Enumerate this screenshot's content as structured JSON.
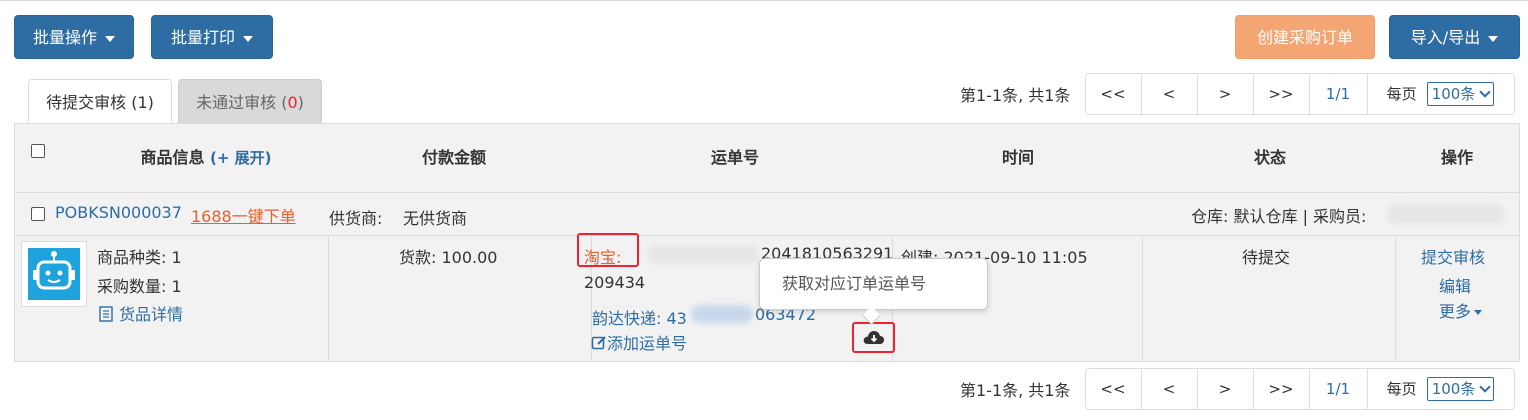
{
  "toolbar": {
    "batch_ops": "批量操作",
    "batch_print": "批量打印",
    "create_po": "创建采购订单",
    "import_export": "导入/导出"
  },
  "tabs": {
    "pending_label": "待提交审核",
    "pending_count": "(1)",
    "rejected_label": "未通过审核",
    "rejected_count_open": "(",
    "rejected_count": "0",
    "rejected_count_close": ")"
  },
  "pager": {
    "summary": "第1-1条, 共1条",
    "first": "<<",
    "prev": "<",
    "next": ">",
    "last": ">>",
    "page": "1/1",
    "per_page_label": "每页",
    "per_page_value": "100条"
  },
  "table": {
    "headers": {
      "product": "商品信息",
      "expand": "(+ 展开)",
      "amount": "付款金额",
      "tracking": "运单号",
      "time": "时间",
      "status": "状态",
      "action": "操作"
    },
    "order": {
      "po_number": "POBKSN000037",
      "quick_order": "1688一键下单",
      "supplier_label": "供货商:",
      "supplier_value": "无供货商",
      "warehouse": "仓库: 默认仓库 | 采购员:"
    },
    "row": {
      "kinds": "商品种类: 1",
      "qty": "采购数量: 1",
      "detail_link": "货品详情",
      "amount": "货款: 100.00",
      "taobao_label": "淘宝:",
      "tracking_tail": "2041810563291",
      "tracking_line2": "209434",
      "express_prefix": "韵达快递: 43",
      "express_tail": "063472",
      "add_tracking": "添加运单号",
      "created": "创建: 2021-09-10 11:05",
      "status": "待提交",
      "action_submit": "提交审核",
      "action_edit": "编辑",
      "action_more": "更多"
    }
  },
  "tooltip": {
    "text": "获取对应订单运单号"
  },
  "colors": {
    "primary": "#2e6da4",
    "orange": "#f4a574",
    "highlight_red": "#e23322",
    "link_orange": "#e8602c"
  }
}
